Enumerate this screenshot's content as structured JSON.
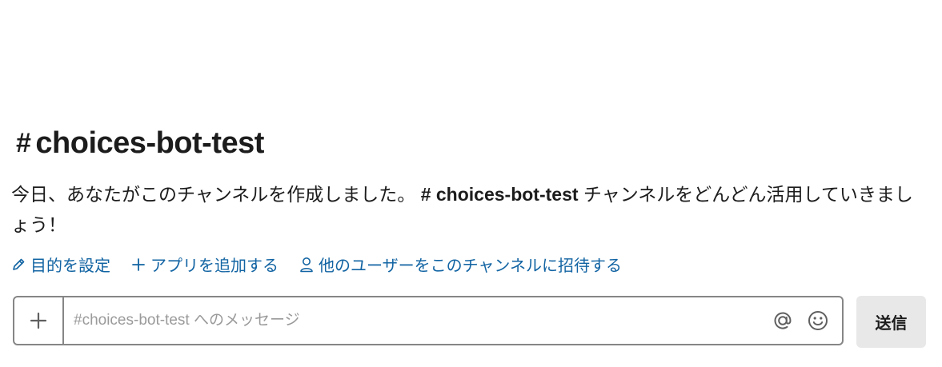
{
  "channel": {
    "hash": "#",
    "name": "choices-bot-test"
  },
  "intro": {
    "text_before": "今日、あなたがこのチャンネルを作成しました。",
    "mention": "# choices-bot-test",
    "text_after": "チャンネルをどんどん活用していきましょう！"
  },
  "actions": [
    {
      "icon": "pencil-icon",
      "label": "目的を設定"
    },
    {
      "icon": "plus-icon",
      "label": "アプリを追加する"
    },
    {
      "icon": "person-icon",
      "label": "他のユーザーをこのチャンネルに招待する"
    }
  ],
  "composer": {
    "placeholder": "#choices-bot-test へのメッセージ",
    "value": "",
    "send_label": "送信"
  },
  "colors": {
    "link": "#1264a3",
    "text": "#1d1c1d",
    "border": "#868686",
    "send_bg": "#e8e8e8"
  }
}
